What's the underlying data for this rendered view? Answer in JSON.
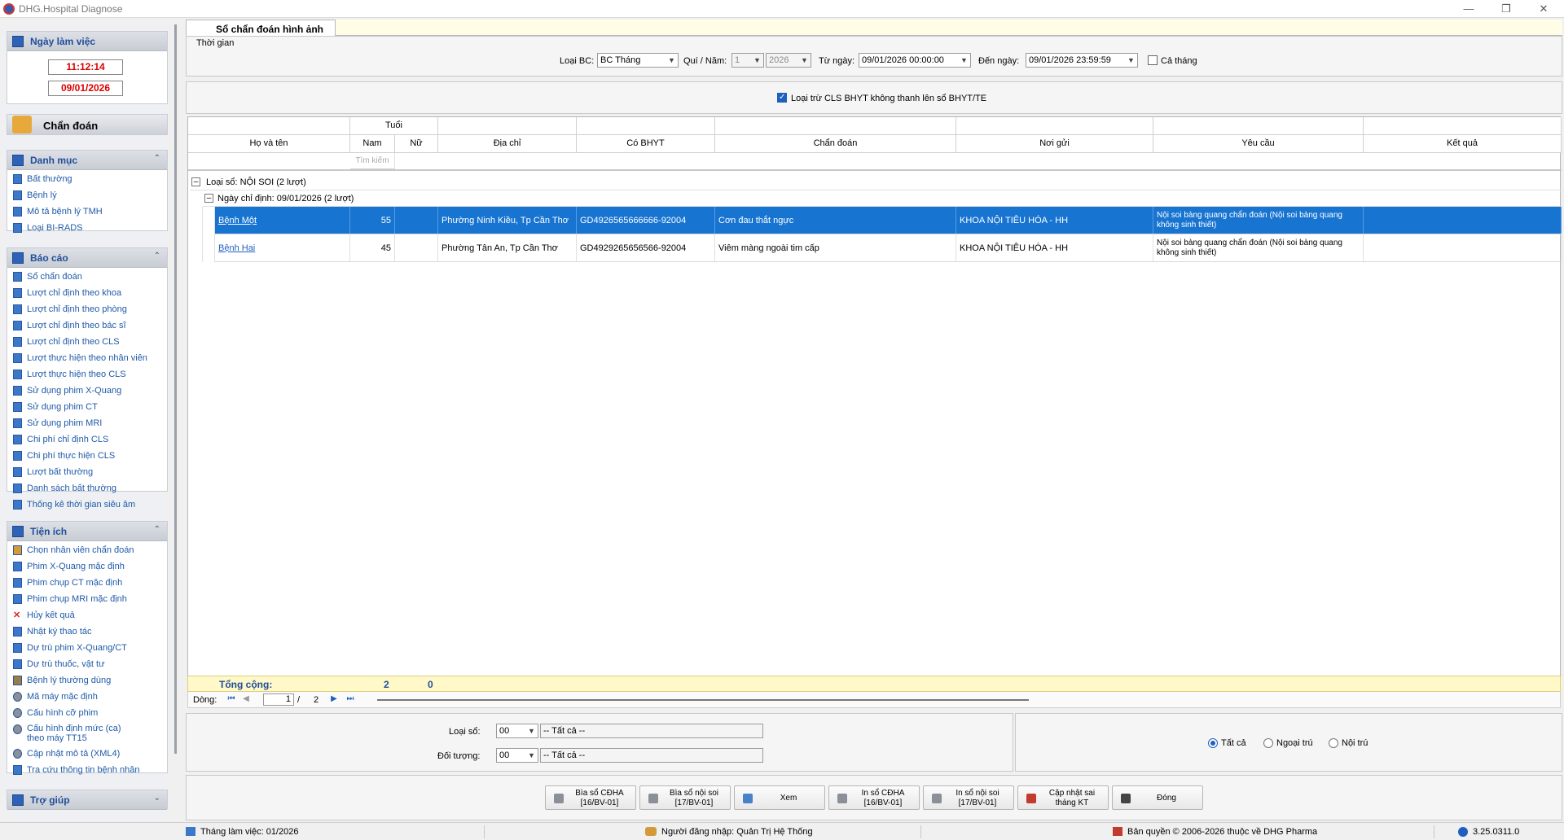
{
  "window": {
    "title": "DHG.Hospital Diagnose"
  },
  "sidebar": {
    "workday": {
      "title": "Ngày làm việc",
      "time": "11:12:14",
      "date": "09/01/2026"
    },
    "chan_doan": {
      "label": "Chẩn đoán"
    },
    "danh_muc": {
      "title": "Danh mục",
      "items": [
        {
          "label": "Bất thường"
        },
        {
          "label": "Bệnh lý"
        },
        {
          "label": "Mô tả bệnh lý TMH"
        },
        {
          "label": "Loại BI-RADS"
        }
      ]
    },
    "bao_cao": {
      "title": "Báo cáo",
      "items": [
        {
          "label": "Sổ chẩn đoán"
        },
        {
          "label": "Lượt chỉ định theo khoa"
        },
        {
          "label": "Lượt chỉ định theo phòng"
        },
        {
          "label": "Lượt chỉ định theo bác sĩ"
        },
        {
          "label": "Lượt chỉ định theo CLS"
        },
        {
          "label": "Lượt thực hiện theo nhân viên"
        },
        {
          "label": "Lượt thực hiện theo CLS"
        },
        {
          "label": "Sử dụng phim X-Quang"
        },
        {
          "label": "Sử dụng phim CT"
        },
        {
          "label": "Sử dụng phim MRI"
        },
        {
          "label": "Chi phí chỉ định CLS"
        },
        {
          "label": "Chi phí thực hiện CLS"
        },
        {
          "label": "Lượt bất thường"
        },
        {
          "label": "Danh sách bất thường"
        },
        {
          "label": "Thống kê thời gian siêu âm"
        }
      ]
    },
    "tien_ich": {
      "title": "Tiện ích",
      "items": [
        {
          "label": "Chọn nhân viên chẩn đoán",
          "icon": "person-icon"
        },
        {
          "label": "Phim X-Quang mặc định",
          "icon": "film-icon"
        },
        {
          "label": "Phim chụp CT mặc định",
          "icon": "film-icon"
        },
        {
          "label": "Phim chụp MRI mặc định",
          "icon": "film-icon"
        },
        {
          "label": "Hủy kết quả",
          "icon": "red-x-icon"
        },
        {
          "label": "Nhật ký thao tác",
          "icon": "log-icon"
        },
        {
          "label": "Dự trù phim X-Quang/CT",
          "icon": "film-icon"
        },
        {
          "label": "Dự trù thuốc, vật tư",
          "icon": "film-icon"
        },
        {
          "label": "Bệnh lý thường dùng",
          "icon": "book-icon"
        },
        {
          "label": "Mã máy mặc định",
          "icon": "gear-icon"
        },
        {
          "label": "Cấu hình cỡ phim",
          "icon": "gear-icon"
        },
        {
          "label": "Cấu hình định mức (ca) theo máy TT15",
          "icon": "gear-icon"
        },
        {
          "label": "Cập nhật mô tả (XML4)",
          "icon": "gear-icon"
        },
        {
          "label": "Tra cứu thông tin bệnh nhân",
          "icon": "search-icon"
        }
      ]
    },
    "tro_giup": {
      "title": "Trợ giúp"
    }
  },
  "main": {
    "tab": "Sổ chẩn đoán hình ảnh",
    "filters": {
      "group_label": "Thời gian",
      "loai_bc_label": "Loại BC:",
      "loai_bc_value": "BC Tháng",
      "quy_nam_label": "Quí / Năm:",
      "quy_value": "1",
      "nam_value": "2026",
      "tu_ngay_label": "Từ ngày:",
      "tu_ngay_value": "09/01/2026 00:00:00",
      "den_ngay_label": "Đến ngày:",
      "den_ngay_value": "09/01/2026 23:59:59",
      "ca_thang_label": "Cả tháng",
      "loai_tru_label": "Loại trừ CLS BHYT không thanh lên sổ BHYT/TE"
    },
    "grid": {
      "headers": {
        "ho_ten": "Họ và tên",
        "tuoi": "Tuổi",
        "nam": "Nam",
        "nu": "Nữ",
        "dia_chi": "Địa chỉ",
        "co_bhyt": "Có BHYT",
        "chan_doan": "Chẩn đoán",
        "noi_gui": "Nơi gửi",
        "yeu_cau": "Yêu cầu",
        "ket_qua": "Kết quả"
      },
      "search_placeholder": "Tìm kiếm",
      "group1": "Loại sổ:  NỘI SOI (2 lượt)",
      "group2": "Ngày chỉ định:  09/01/2026 (2 lượt)",
      "rows": [
        {
          "ho_ten": "Bệnh Một",
          "nam": "55",
          "nu": "",
          "dia_chi": "Phường Ninh Kiều, Tp Cần Thơ",
          "co_bhyt": "GD4926565666666-92004",
          "chan_doan": "Cơn đau thắt ngực",
          "noi_gui": "KHOA NỘI TIÊU HÓA - HH",
          "yeu_cau": "Nội soi bàng quang chẩn đoán (Nội soi bàng quang không sinh thiết)",
          "ket_qua": ""
        },
        {
          "ho_ten": "Bệnh Hai",
          "nam": "45",
          "nu": "",
          "dia_chi": "Phường Tân An, Tp Cần Thơ",
          "co_bhyt": "GD4929265656566-92004",
          "chan_doan": "Viêm màng ngoài tim cấp",
          "noi_gui": "KHOA NỘI TIÊU HÓA - HH",
          "yeu_cau": "Nội soi bàng quang chẩn đoán (Nội soi bàng quang không sinh thiết)",
          "ket_qua": ""
        }
      ],
      "totals": {
        "label": "Tổng cộng:",
        "nam": "2",
        "nu": "0"
      },
      "nav": {
        "label": "Dòng:",
        "current": "1",
        "sep": "/",
        "total": "2"
      }
    },
    "bottom": {
      "loai_so_label": "Loại sổ:",
      "loai_so_code": "00",
      "loai_so_text": "-- Tất cả --",
      "doi_tuong_label": "Đối tượng:",
      "doi_tuong_code": "00",
      "doi_tuong_text": "-- Tất cả --",
      "radio_all": "Tất cả",
      "radio_ngoai": "Ngoại trú",
      "radio_noi": "Nội trú"
    },
    "buttons": {
      "bia_cdha_1": "Bìa sổ CĐHA",
      "bia_cdha_2": "[16/BV-01]",
      "bia_noisoi_1": "Bìa sổ nội soi",
      "bia_noisoi_2": "[17/BV-01]",
      "xem": "Xem",
      "in_cdha_1": "In sổ CĐHA",
      "in_cdha_2": "[16/BV-01]",
      "in_noisoi_1": "In sổ nội soi",
      "in_noisoi_2": "[17/BV-01]",
      "capnhat_1": "Cập nhật sai",
      "capnhat_2": "tháng KT",
      "dong": "Đóng"
    }
  },
  "status": {
    "thang": "Tháng làm việc: 01/2026",
    "user": "Người đăng nhập: Quản Trị Hệ Thống",
    "copyright": "Bản quyền © 2006-2026 thuộc về DHG Pharma",
    "version": "3.25.0311.0"
  }
}
